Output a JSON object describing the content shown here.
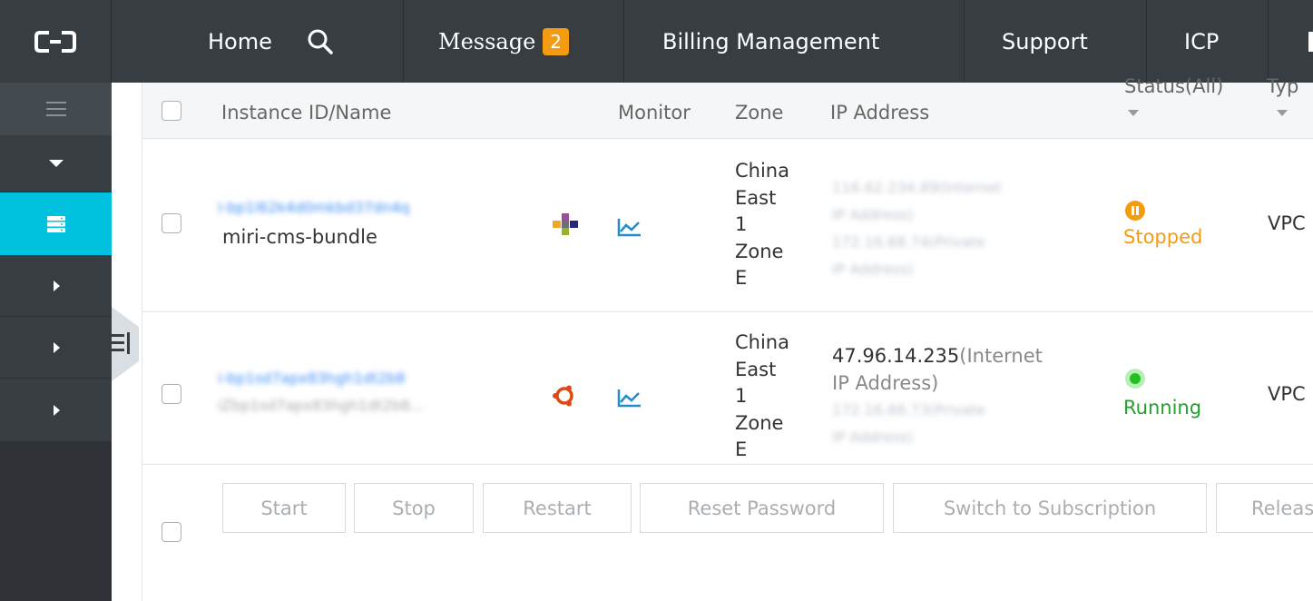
{
  "nav": {
    "home": "Home",
    "message": "Message",
    "message_count": "2",
    "billing": "Billing Management",
    "support": "Support",
    "icp": "ICP"
  },
  "table": {
    "headers": {
      "instance": "Instance ID/Name",
      "monitor": "Monitor",
      "zone": "Zone",
      "ip": "IP Address",
      "status": "Status(All)",
      "type": "Typ"
    },
    "rows": [
      {
        "id_blurred": "i-bp1l62k4d0mkbd37dn4q",
        "name": "miri-cms-bundle",
        "zone_lines": [
          "China",
          "East",
          "1",
          "Zone",
          "E"
        ],
        "ip_public": "116.62.234.89",
        "ip_public_suffix": "(Internet",
        "ip_public_suffix2": "IP Address)",
        "ip_private": "172.16.68.74",
        "ip_private_suffix": "(Private",
        "ip_private_suffix2": "IP Address)",
        "status": "Stopped",
        "type": "VPC"
      },
      {
        "id_blurred": "i-bp1sd7apx83hgh1dt2b8",
        "name_blurred": "iZbp1sd7apx83hgh1dt2b8...",
        "zone_lines": [
          "China",
          "East",
          "1",
          "Zone",
          "E"
        ],
        "ip_public": "47.96.14.235",
        "ip_public_suffix": "(Internet",
        "ip_public_suffix2": "IP Address)",
        "ip_private": "172.16.68.73",
        "ip_private_suffix": "(Private",
        "ip_private_suffix2": "IP Address)",
        "status": "Running",
        "type": "VPC"
      }
    ]
  },
  "actions": {
    "start": "Start",
    "stop": "Stop",
    "restart": "Restart",
    "reset_password": "Reset Password",
    "switch": "Switch to Subscription",
    "release": "Releas"
  },
  "colors": {
    "nav_bg": "#373d41",
    "sidebar_active": "#00c1de",
    "stopped": "#f39c12",
    "running": "#22a12d",
    "link": "#3e8ef7"
  }
}
